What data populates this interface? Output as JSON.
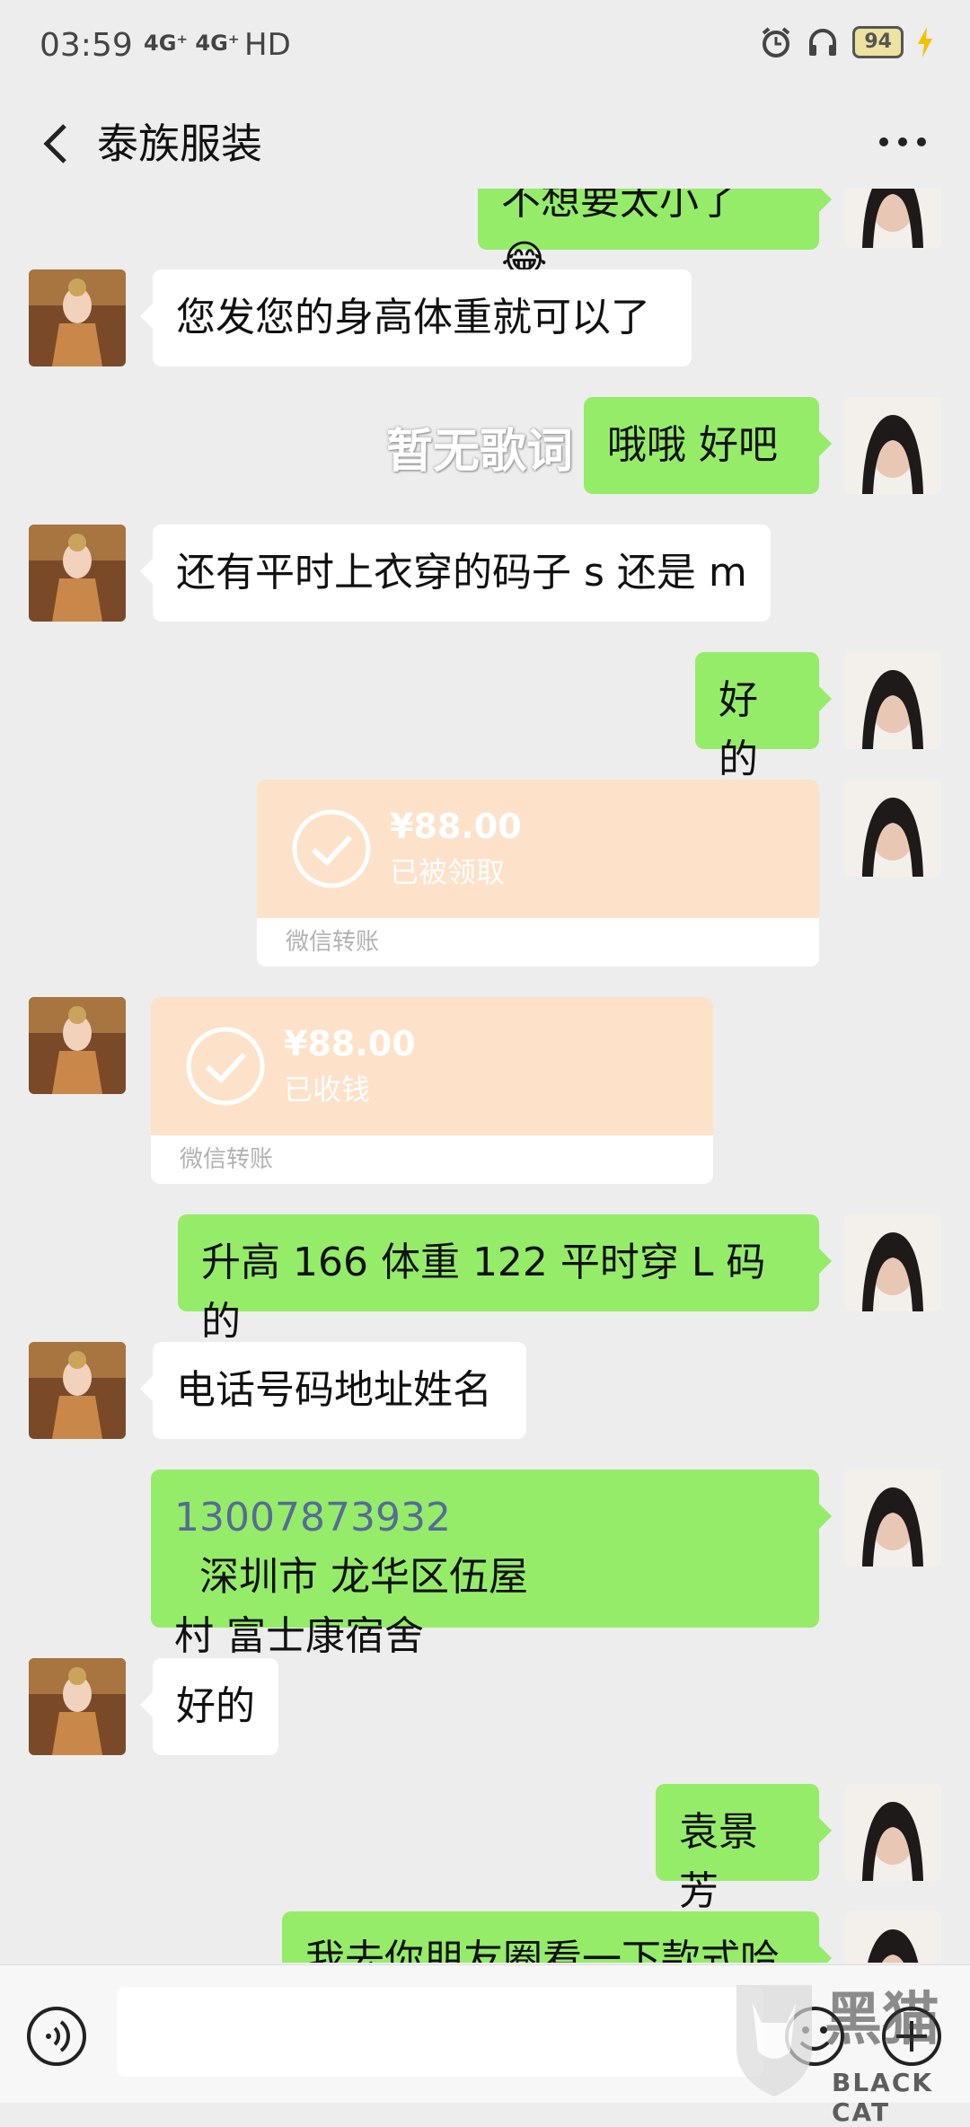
{
  "status_bar": {
    "time": "03:59",
    "network": "4G⁺ 4G⁺",
    "hd": "HD",
    "battery": "94"
  },
  "header": {
    "back_icon": "chevron-left-icon",
    "title": "泰族服装",
    "more_icon": "more-dots-icon"
  },
  "overlay": {
    "lyric": "暂无歌词"
  },
  "messages": [
    {
      "side": "out",
      "text": "不想要太小了"
    },
    {
      "side": "in",
      "text": "您发您的身高体重就可以了"
    },
    {
      "side": "out",
      "text": "哦哦 好吧"
    },
    {
      "side": "in",
      "text": "还有平时上衣穿的码子 s 还是 m"
    },
    {
      "side": "out",
      "text": "好的"
    },
    {
      "side": "out",
      "type": "transfer",
      "amount": "¥88.00",
      "state": "已被领取",
      "footer": "微信转账"
    },
    {
      "side": "in",
      "type": "transfer",
      "amount": "¥88.00",
      "state": "已收钱",
      "footer": "微信转账"
    },
    {
      "side": "out",
      "text": "升高 166  体重 122  平时穿 L 码的"
    },
    {
      "side": "in",
      "text": "电话号码地址姓名"
    },
    {
      "side": "out",
      "phone": "13007873932",
      "text_line1": "  深圳市 龙华区伍屋",
      "text_line2": "村 富士康宿舍"
    },
    {
      "side": "in",
      "text": "好的"
    },
    {
      "side": "out",
      "text": "袁景芳"
    },
    {
      "side": "out",
      "text": "我去你朋友圈看一下款式哈"
    }
  ],
  "input_bar": {
    "voice_icon": "voice-icon",
    "emoji_icon": "emoji-icon",
    "plus_icon": "plus-icon"
  },
  "watermark": {
    "text": "BLACK CAT"
  },
  "colors": {
    "background": "#ededed",
    "outgoing_bubble": "#95ec69",
    "incoming_bubble": "#ffffff",
    "transfer_bg": "#fde1c9",
    "phone_link": "#576b95"
  }
}
